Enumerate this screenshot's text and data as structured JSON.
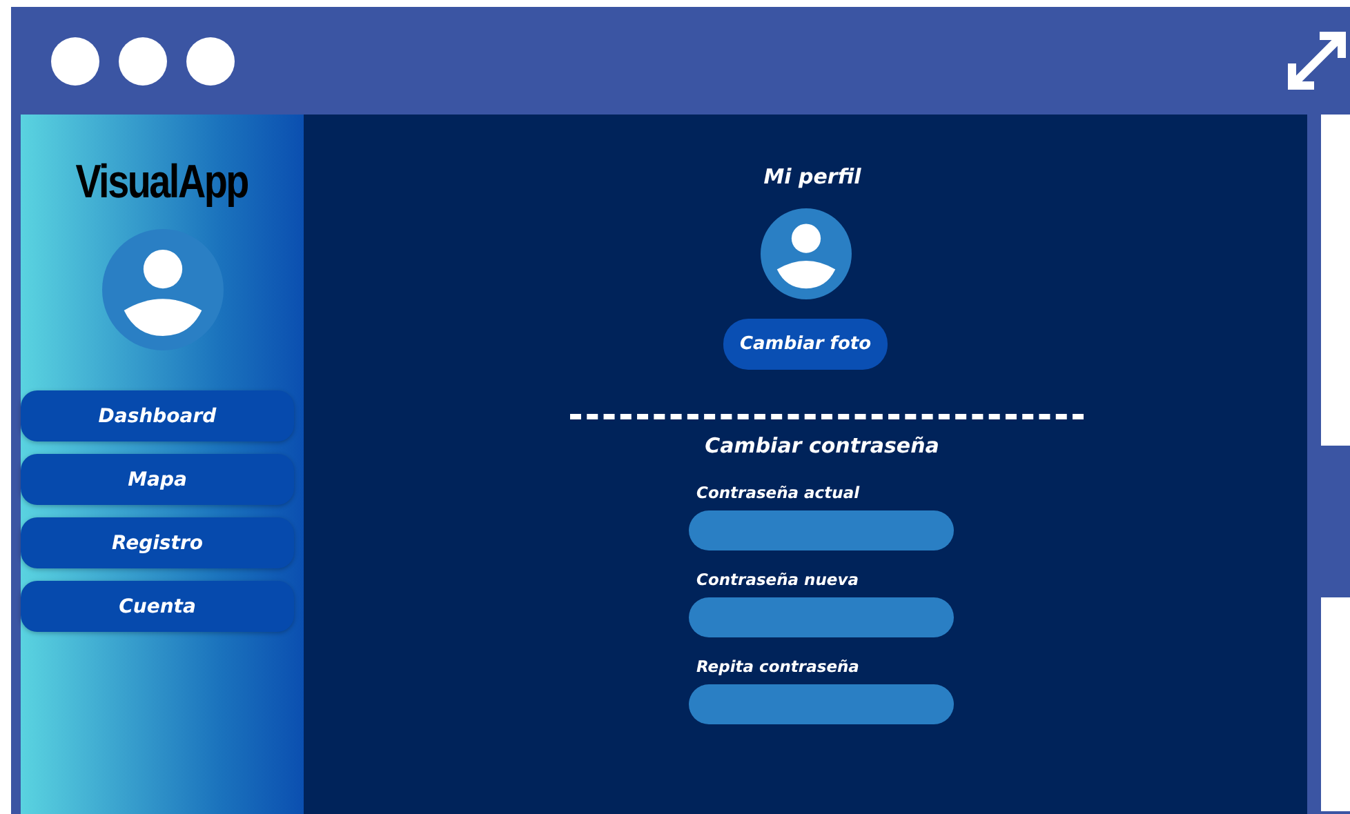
{
  "sidebar": {
    "logo": "VisualApp",
    "items": [
      {
        "label": "Dashboard"
      },
      {
        "label": "Mapa"
      },
      {
        "label": "Registro"
      },
      {
        "label": "Cuenta"
      }
    ]
  },
  "profile": {
    "title": "Mi perfil",
    "button": "Cambiar foto"
  },
  "password": {
    "title": "Cambiar contraseña",
    "fields": [
      {
        "label": "Contraseña actual"
      },
      {
        "label": "Contraseña nueva"
      },
      {
        "label": "Repita contraseña"
      }
    ]
  }
}
